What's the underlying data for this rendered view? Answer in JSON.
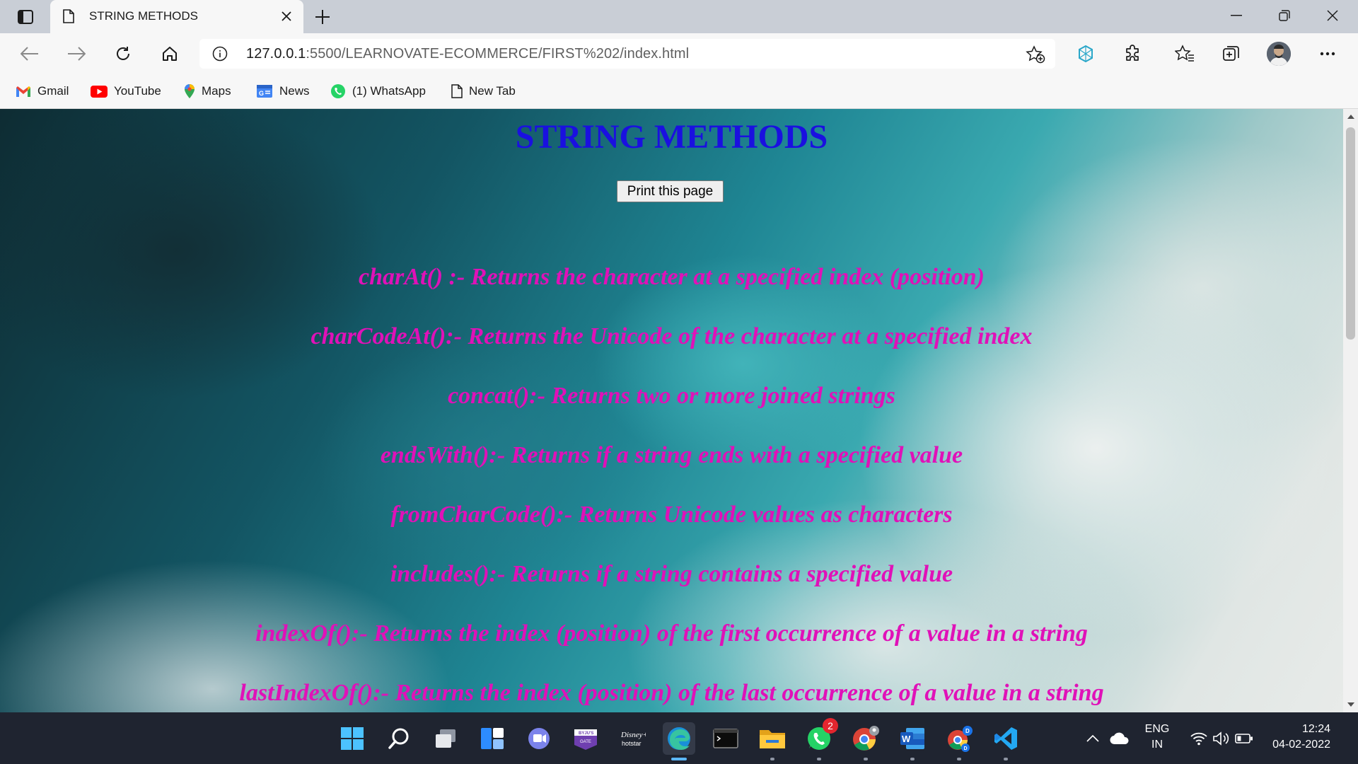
{
  "browser": {
    "tab_title": "STRING METHODS",
    "url_host": "127.0.0.1",
    "url_rest": ":5500/LEARNOVATE-ECOMMERCE/FIRST%202/index.html"
  },
  "bookmarks": [
    {
      "label": "Gmail",
      "icon": "gmail-icon"
    },
    {
      "label": "YouTube",
      "icon": "youtube-icon"
    },
    {
      "label": "Maps",
      "icon": "maps-icon"
    },
    {
      "label": "News",
      "icon": "news-icon"
    },
    {
      "label": "(1) WhatsApp",
      "icon": "whatsapp-icon"
    },
    {
      "label": "New Tab",
      "icon": "page-icon"
    }
  ],
  "page": {
    "heading": "STRING METHODS",
    "print_button": "Print this page",
    "methods": [
      "charAt() :- Returns the character at a specified index (position)",
      "charCodeAt():- Returns the Unicode of the character at a specified index",
      "concat():- Returns two or more joined strings",
      "endsWith():- Returns if a string ends with a specified value",
      "fromCharCode():- Returns Unicode values as characters",
      "includes():- Returns if a string contains a specified value",
      "indexOf():- Returns the index (position) of the first occurrence of a value in a string",
      "lastIndexOf():- Returns the index (position) of the last occurrence of a value in a string"
    ],
    "colors": {
      "heading": "#1a10e0",
      "methods": "#e011b8"
    }
  },
  "taskbar": {
    "whatsapp_badge": "2",
    "language": "ENG",
    "region": "IN",
    "time": "12:24",
    "date": "04-02-2022"
  }
}
